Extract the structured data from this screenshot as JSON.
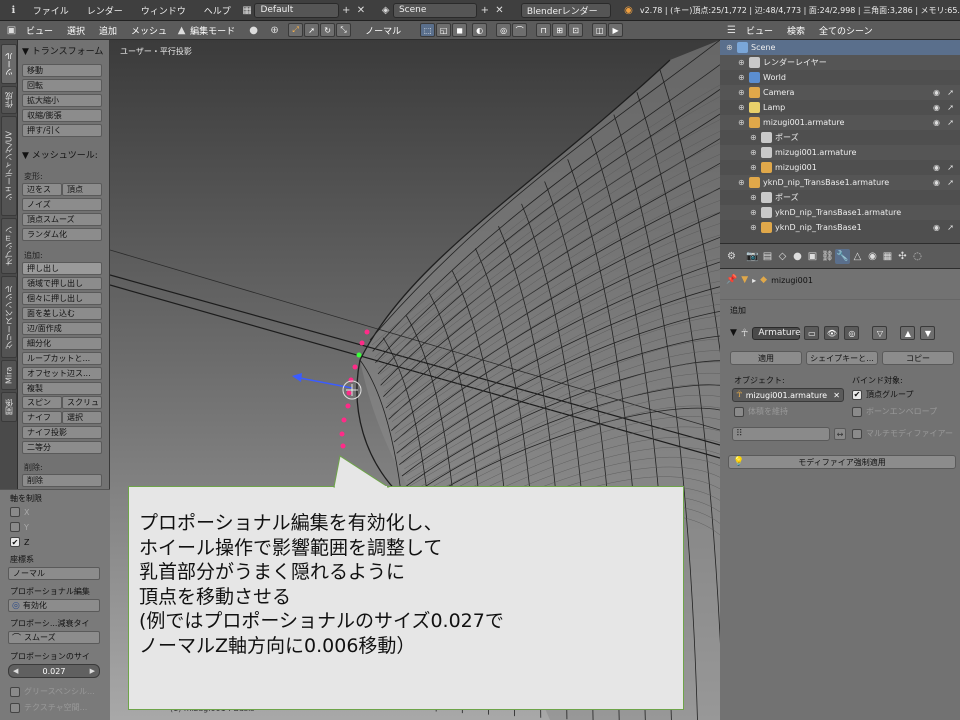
{
  "topbar": {
    "menus": [
      "ファイル",
      "レンダー",
      "ウィンドウ",
      "ヘルプ"
    ],
    "layout": "Default",
    "scene": "Scene",
    "engine": "Blenderレンダー",
    "stats": "v2.78 | (キー)頂点:25/1,772 | 辺:48/4,773 | 面:24/2,998 | 三角面:3,286 | メモリ:65."
  },
  "view_header": {
    "menus": [
      "ビュー",
      "選択",
      "追加",
      "メッシュ"
    ],
    "mode": "編集モード",
    "orientation": "ノーマル"
  },
  "tabs": [
    "ツール",
    "作成",
    "シェーディング/UV",
    "オプション",
    "グリースペンシル",
    "Mira",
    "関係"
  ],
  "shelf": {
    "transform_header": "▼ トランスフォーム",
    "transform_buttons": [
      "移動",
      "回転",
      "拡大縮小",
      "収縮/膨張",
      "押す/引く"
    ],
    "mesh_tools_header": "▼ メッシュツール:",
    "deform_label": "変形:",
    "slide_edge": "辺をス",
    "slide_vertex": "頂点",
    "deform_buttons": [
      "ノイズ",
      "頂点スムーズ",
      "ランダム化"
    ],
    "add_label": "追加:",
    "extrude": "押し出し",
    "add_buttons": [
      "領域で押し出し",
      "個々に押し出し",
      "面を差し込む",
      "辺/面作成",
      "細分化",
      "ループカットと...",
      "オフセット辺ス...",
      "複製"
    ],
    "spin": "スピン",
    "screw": "スクリュ",
    "knife": "ナイフ",
    "select": "選択",
    "knife_project": "ナイフ投影",
    "bisect": "二等分",
    "delete_label": "削除:",
    "delete": "削除",
    "axis_constraint": "軸を制限",
    "axis_x": "X",
    "axis_y": "Y",
    "axis_z": "Z",
    "coord_system_label": "座標系",
    "coord_system": "ノーマル",
    "prop_edit_label": "プロポーショナル編集",
    "prop_edit_value": "有効化",
    "prop_falloff_label": "プロポーシ...減衰タイ",
    "prop_falloff_value": "スムーズ",
    "prop_size_label": "プロポーションのサイ",
    "prop_size_value": "0.027",
    "greasepencil_label": "グリースペンシル...",
    "texture_space_label": "テクスチャ空間..."
  },
  "viewport": {
    "view_name": "ユーザー・平行投影",
    "object_info": "(1) mizugi001 : Basis"
  },
  "outliner_header": {
    "menus": [
      "ビュー",
      "検索"
    ],
    "filter": "全てのシーン"
  },
  "outliner": {
    "rows": [
      {
        "label": "Scene",
        "indent": 0,
        "color": "#7aa6d8",
        "eye": false
      },
      {
        "label": "レンダーレイヤー",
        "indent": 1,
        "color": "#c9c9c9",
        "eye": false
      },
      {
        "label": "World",
        "indent": 1,
        "color": "#5b8ed0",
        "eye": false
      },
      {
        "label": "Camera",
        "indent": 1,
        "color": "#e0a84a",
        "eye": true
      },
      {
        "label": "Lamp",
        "indent": 1,
        "color": "#e8d06a",
        "eye": true
      },
      {
        "label": "mizugi001.armature",
        "indent": 1,
        "color": "#e0a84a",
        "eye": true
      },
      {
        "label": "ポーズ",
        "indent": 2,
        "color": "#c9c9c9",
        "eye": false
      },
      {
        "label": "mizugi001.armature",
        "indent": 2,
        "color": "#c9c9c9",
        "eye": false
      },
      {
        "label": "mizugi001",
        "indent": 2,
        "color": "#e0a84a",
        "eye": true
      },
      {
        "label": "yknD_nip_TransBase1.armature",
        "indent": 1,
        "color": "#e0a84a",
        "eye": true
      },
      {
        "label": "ポーズ",
        "indent": 2,
        "color": "#c9c9c9",
        "eye": false
      },
      {
        "label": "yknD_nip_TransBase1.armature",
        "indent": 2,
        "color": "#c9c9c9",
        "eye": false
      },
      {
        "label": "yknD_nip_TransBase1",
        "indent": 2,
        "color": "#e0a84a",
        "eye": true
      }
    ]
  },
  "props": {
    "breadcrumb": "mizugi001",
    "add_label": "追加",
    "modifier_name": "Armature",
    "apply": "適用",
    "shape_key": "シェイプキーと...",
    "copy": "コピー",
    "object_label": "オブジェクト:",
    "object_value": "mizugi001.armature",
    "bind_label": "バインド対象:",
    "vertex_groups": "頂点グループ",
    "preserve_volume": "体積を維持",
    "bone_envelope": "ボーンエンベロープ",
    "multi_modifier": "マルチモディファイアー",
    "force_apply": "モディファイア強制適用"
  },
  "callout": {
    "lines": [
      "プロポーショナル編集を有効化し、",
      "ホイール操作で影響範囲を調整して",
      "乳首部分がうまく隠れるように",
      "頂点を移動させる",
      "(例ではプロポーショナルのサイズ0.027で",
      " ノーマルZ軸方向に0.006移動）"
    ]
  },
  "colors": {
    "accent_blue": "#5a6f8c",
    "callout_border": "#6ea44a",
    "vertex_selected": "#ff2b88",
    "gizmo_blue": "#3b5cff",
    "gizmo_green": "#3cff3c"
  }
}
